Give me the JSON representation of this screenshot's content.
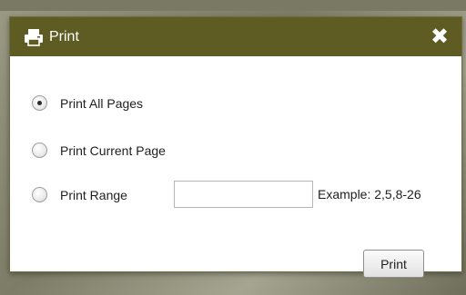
{
  "dialog": {
    "title": "Print",
    "title_icon": "printer-icon",
    "close_icon": "close-icon",
    "title_bar_color": "#5e5b23"
  },
  "options": [
    {
      "label": "Print All Pages",
      "checked": true
    },
    {
      "label": "Print Current Page",
      "checked": false
    },
    {
      "label": "Print Range",
      "checked": false
    }
  ],
  "range": {
    "value": "",
    "example": "Example: 2,5,8-26"
  },
  "actions": {
    "print_label": "Print"
  },
  "glyphs": {
    "close": "✖"
  }
}
